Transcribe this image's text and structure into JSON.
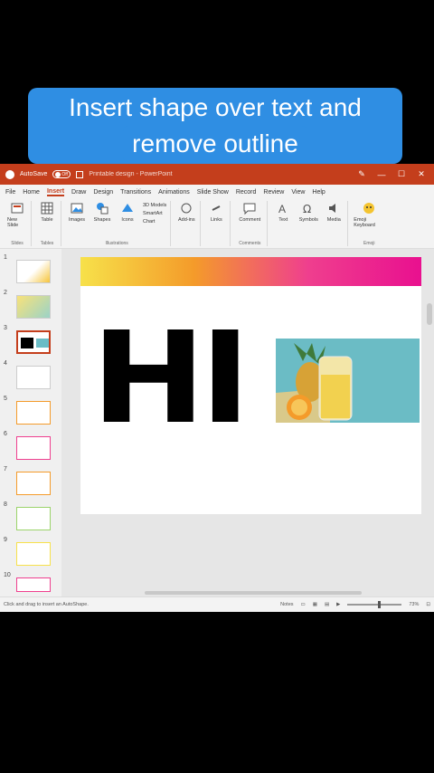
{
  "caption": {
    "line1": "Insert shape over text and",
    "line2": "remove outline"
  },
  "titlebar": {
    "autosave": "AutoSave",
    "toggle": "Off",
    "filename": "Printable design - PowerPoint"
  },
  "tabs": [
    "File",
    "Home",
    "Insert",
    "Draw",
    "Design",
    "Transitions",
    "Animations",
    "Slide Show",
    "Record",
    "Review",
    "View",
    "Help"
  ],
  "ribbon": {
    "slides": {
      "label": "New Slide",
      "group": "Slides"
    },
    "tables": {
      "label": "Table",
      "group": "Tables"
    },
    "images": {
      "label": "Images"
    },
    "shapes": {
      "label": "Shapes"
    },
    "icons": {
      "label": "Icons"
    },
    "models": "3D Models",
    "smartart": "SmartArt",
    "chart": "Chart",
    "illus_group": "Illustrations",
    "addins": "Add-ins",
    "links": "Links",
    "comment": {
      "label": "Comment",
      "group": "Comments"
    },
    "text": "Text",
    "symbols": "Symbols",
    "media": "Media",
    "emoji": {
      "label": "Emoji Keyboard",
      "group": "Emoji"
    }
  },
  "thumbnails": [
    "1",
    "2",
    "3",
    "4",
    "5",
    "6",
    "7",
    "8",
    "9",
    "10"
  ],
  "slide": {
    "big_text": "HI"
  },
  "status": {
    "hint": "Click and drag to insert an AutoShape.",
    "notes": "Notes",
    "zoom": "73%"
  },
  "colors": {
    "accent": "#c43e1c",
    "caption_bg": "#2f8ee3"
  }
}
